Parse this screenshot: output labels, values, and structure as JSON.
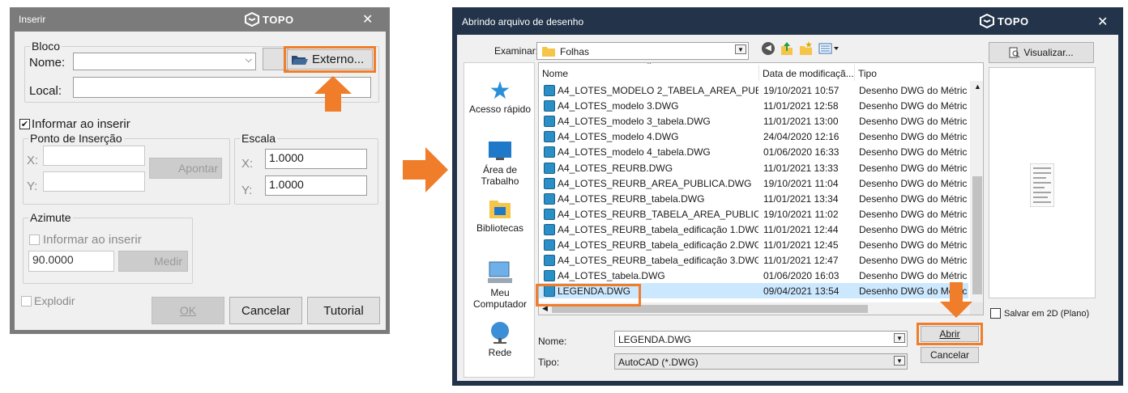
{
  "brand": {
    "name": "TOPO"
  },
  "inserir": {
    "title": "Inserir",
    "bloco": {
      "legend": "Bloco",
      "nome_label": "Nome:",
      "nome_value": "",
      "local_label": "Local:",
      "local_value": "",
      "externo_label": "Externo..."
    },
    "informar_checkbox": {
      "label": "Informar ao inserir",
      "checked": true
    },
    "ponto": {
      "legend": "Ponto de Inserção",
      "x_label": "X:",
      "y_label": "Y:",
      "x_value": "",
      "y_value": "",
      "apontar_label": "Apontar"
    },
    "escala": {
      "legend": "Escala",
      "x_label": "X:",
      "y_label": "Y:",
      "x_value": "1.0000",
      "y_value": "1.0000"
    },
    "azimute": {
      "legend": "Azimute",
      "informar_label": "Informar ao inserir",
      "value": "90.0000",
      "medir_label": "Medir"
    },
    "explodir_label": "Explodir",
    "ok_label": "OK",
    "cancelar_label": "Cancelar",
    "tutorial_label": "Tutorial"
  },
  "abrir": {
    "title": "Abrindo arquivo de desenho",
    "examinar_label": "Examinar:",
    "folder": "Folhas",
    "visualizar_label": "Visualizar...",
    "places": [
      {
        "label": "Acesso rápido",
        "icon": "star-icon"
      },
      {
        "label": "Área de Trabalho",
        "icon": "desktop-icon"
      },
      {
        "label": "Bibliotecas",
        "icon": "libraries-icon"
      },
      {
        "label": "Meu Computador",
        "icon": "computer-icon"
      },
      {
        "label": "Rede",
        "icon": "network-icon"
      }
    ],
    "columns": [
      "Nome",
      "Data de modificaçã...",
      "Tipo"
    ],
    "files": [
      {
        "name": "A4_LOTES_MODELO 2_TABELA_AREA_PUBLI...",
        "date": "19/10/2021 10:57",
        "type": "Desenho DWG do Métric"
      },
      {
        "name": "A4_LOTES_modelo 3.DWG",
        "date": "11/01/2021 12:58",
        "type": "Desenho DWG do Métric"
      },
      {
        "name": "A4_LOTES_modelo 3_tabela.DWG",
        "date": "11/01/2021 13:00",
        "type": "Desenho DWG do Métric"
      },
      {
        "name": "A4_LOTES_modelo 4.DWG",
        "date": "24/04/2020 12:16",
        "type": "Desenho DWG do Métric"
      },
      {
        "name": "A4_LOTES_modelo 4_tabela.DWG",
        "date": "01/06/2020 16:33",
        "type": "Desenho DWG do Métric"
      },
      {
        "name": "A4_LOTES_REURB.DWG",
        "date": "11/01/2021 13:33",
        "type": "Desenho DWG do Métric"
      },
      {
        "name": "A4_LOTES_REURB_AREA_PUBLICA.DWG",
        "date": "19/10/2021 11:04",
        "type": "Desenho DWG do Métric"
      },
      {
        "name": "A4_LOTES_REURB_tabela.DWG",
        "date": "11/01/2021 13:34",
        "type": "Desenho DWG do Métric"
      },
      {
        "name": "A4_LOTES_REURB_TABELA_AREA_PUBLICA.D...",
        "date": "19/10/2021 11:02",
        "type": "Desenho DWG do Métric"
      },
      {
        "name": "A4_LOTES_REURB_tabela_edificação 1.DWG",
        "date": "11/01/2021 12:44",
        "type": "Desenho DWG do Métric"
      },
      {
        "name": "A4_LOTES_REURB_tabela_edificação 2.DWG",
        "date": "11/01/2021 12:45",
        "type": "Desenho DWG do Métric"
      },
      {
        "name": "A4_LOTES_REURB_tabela_edificação 3.DWG",
        "date": "11/01/2021 12:47",
        "type": "Desenho DWG do Métric"
      },
      {
        "name": "A4_LOTES_tabela.DWG",
        "date": "01/06/2020 16:03",
        "type": "Desenho DWG do Métric"
      },
      {
        "name": "LEGENDA.DWG",
        "date": "09/04/2021 13:54",
        "type": "Desenho DWG do Métric"
      }
    ],
    "selected_index": 13,
    "nome_label": "Nome:",
    "nome_value": "LEGENDA.DWG",
    "tipo_label": "Tipo:",
    "tipo_value": "AutoCAD (*.DWG)",
    "abrir_label": "Abrir",
    "cancelar_label": "Cancelar",
    "salvar2d_label": "Salvar em 2D (Plano)"
  },
  "colors": {
    "highlight": "#f07d2a",
    "selection": "#cce8ff",
    "dialog1_frame": "#7b7b7b",
    "dialog2_frame": "#23344a"
  }
}
